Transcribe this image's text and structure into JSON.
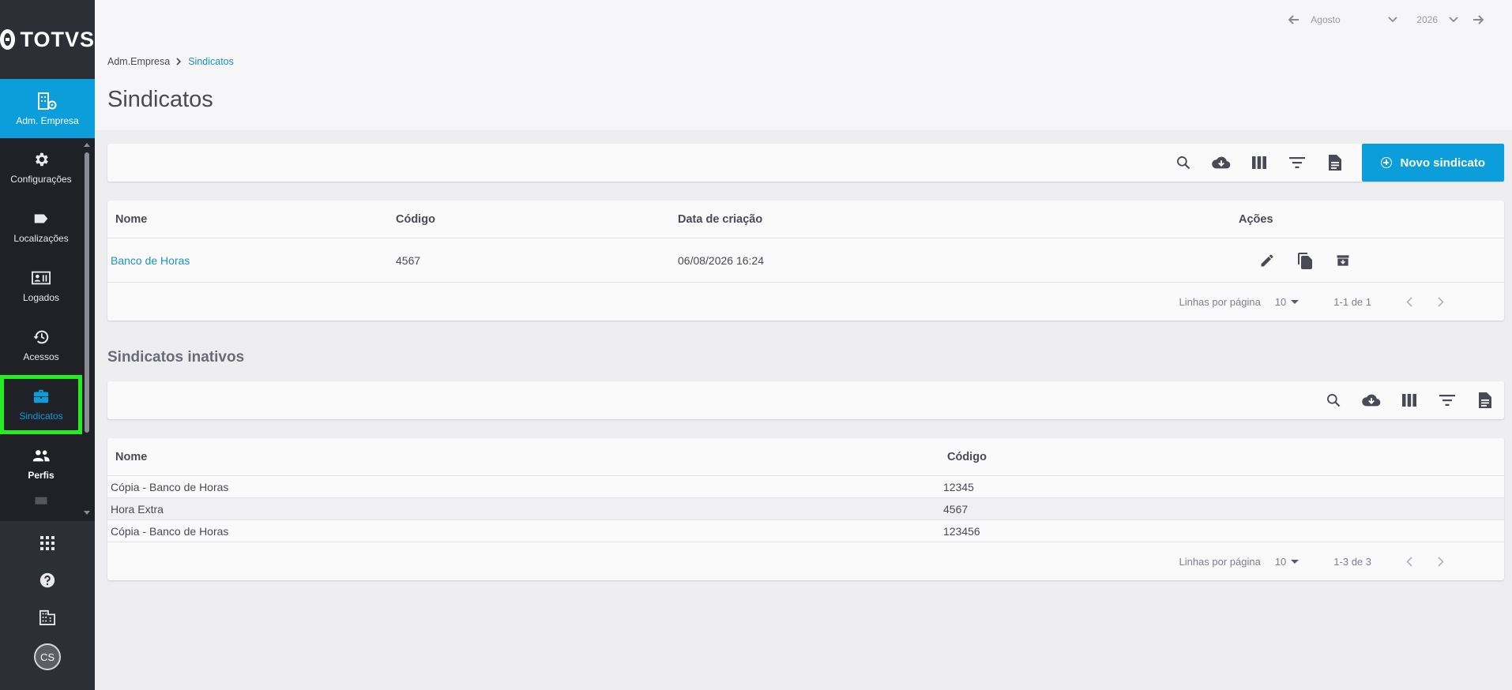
{
  "sidebar": {
    "logo_text": "TOTVS",
    "active_module": {
      "label": "Adm. Empresa",
      "icon": "building-gear-icon"
    },
    "items": [
      {
        "label": "Configurações",
        "icon": "gear-icon"
      },
      {
        "label": "Localizações",
        "icon": "tag-icon"
      },
      {
        "label": "Logados",
        "icon": "id-card-icon"
      },
      {
        "label": "Acessos",
        "icon": "history-icon"
      },
      {
        "label": "Sindicatos",
        "icon": "briefcase-icon"
      },
      {
        "label": "Perfis",
        "icon": "people-icon"
      }
    ],
    "bottom_icons": [
      "apps-grid-icon",
      "help-icon",
      "building-icon"
    ],
    "avatar_initials": "CS"
  },
  "header": {
    "month": "Agosto",
    "year": "2026",
    "breadcrumb": {
      "parent": "Adm.Empresa",
      "current": "Sindicatos"
    },
    "title": "Sindicatos"
  },
  "active_table": {
    "new_button": "Novo sindicato",
    "columns": [
      "Nome",
      "Código",
      "Data de criação",
      "Ações"
    ],
    "rows": [
      {
        "nome": "Banco de Horas",
        "codigo": "4567",
        "data": "06/08/2026 16:24"
      }
    ],
    "pager": {
      "rows_label": "Linhas por página",
      "rows_value": "10",
      "range": "1-1 de 1"
    }
  },
  "inactive_table": {
    "title": "Sindicatos inativos",
    "columns": [
      "Nome",
      "Código"
    ],
    "rows": [
      {
        "nome": "Cópia - Banco de Horas",
        "codigo": "12345"
      },
      {
        "nome": "Hora Extra",
        "codigo": "4567"
      },
      {
        "nome": "Cópia - Banco de Horas",
        "codigo": "123456"
      }
    ],
    "pager": {
      "rows_label": "Linhas por página",
      "rows_value": "10",
      "range": "1-3 de 3"
    }
  },
  "colors": {
    "accent": "#0c9edb",
    "sidebar": "#2d2f36",
    "highlight": "#22ee22"
  }
}
